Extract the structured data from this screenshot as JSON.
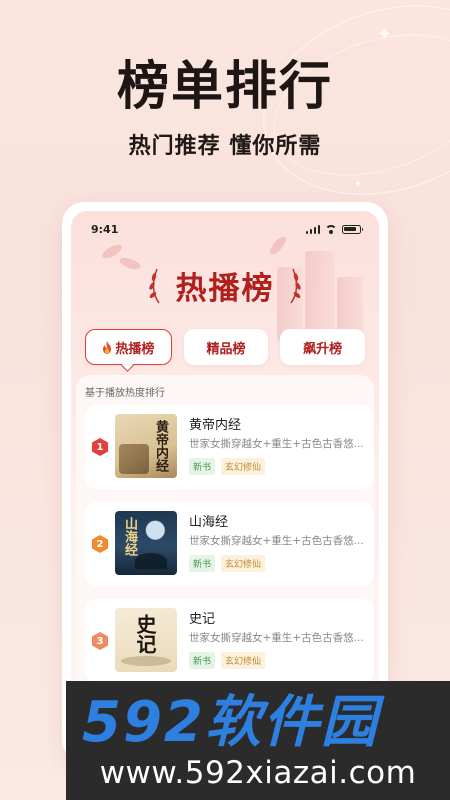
{
  "hero": {
    "title": "榜单排行",
    "subtitle": "热门推荐 懂你所需"
  },
  "phone": {
    "status_time": "9:41",
    "banner_title": "热播榜",
    "tabs": [
      {
        "label": "热播榜",
        "active": true,
        "icon": "flame-icon"
      },
      {
        "label": "精品榜",
        "active": false
      },
      {
        "label": "飙升榜",
        "active": false
      }
    ],
    "list_caption": "基于播放热度排行",
    "books": [
      {
        "rank": "1",
        "title": "黄帝内经",
        "cover_text": "黄帝内经",
        "desc": "世家女撕穿越女+重生+古色古香悠...",
        "tags": [
          "新书",
          "玄幻修仙"
        ],
        "rank_color": "#e2403a"
      },
      {
        "rank": "2",
        "title": "山海经",
        "cover_text": "山海经",
        "desc": "世家女撕穿越女+重生+古色古香悠...",
        "tags": [
          "新书",
          "玄幻修仙"
        ],
        "rank_color": "#f08a2c"
      },
      {
        "rank": "3",
        "title": "史记",
        "cover_text": "史记",
        "desc": "世家女撕穿越女+重生+古色古香悠...",
        "tags": [
          "新书",
          "玄幻修仙"
        ],
        "rank_color": "#ee8a60"
      }
    ]
  },
  "watermark": {
    "logo_text": "592软件园",
    "url": "www.592xiazai.com"
  },
  "colors": {
    "accent_red": "#b0211e",
    "logo_blue": "#2d7fe0"
  }
}
